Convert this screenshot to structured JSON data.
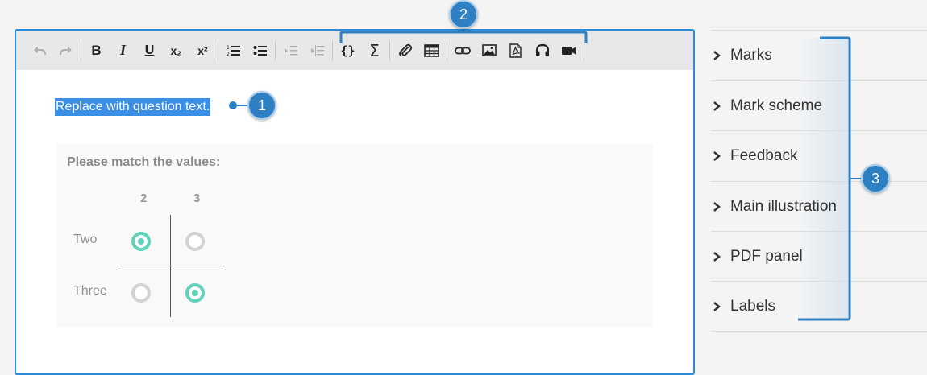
{
  "toolbar": {
    "buttons": [
      {
        "name": "undo",
        "icon": "undo-icon",
        "glyph": "↶"
      },
      {
        "name": "redo",
        "icon": "redo-icon",
        "glyph": "↷"
      },
      {
        "name": "bold",
        "label": "B"
      },
      {
        "name": "italic",
        "label": "I"
      },
      {
        "name": "underline",
        "label": "U"
      },
      {
        "name": "subscript",
        "label": "x₂"
      },
      {
        "name": "superscript",
        "label": "x²"
      },
      {
        "name": "ordered-list",
        "icon": "ordered-list-icon"
      },
      {
        "name": "bullet-list",
        "icon": "bullet-list-icon"
      },
      {
        "name": "outdent",
        "icon": "outdent-icon"
      },
      {
        "name": "indent",
        "icon": "indent-icon"
      },
      {
        "name": "variable",
        "label": "{}"
      },
      {
        "name": "math",
        "label": "Σ"
      },
      {
        "name": "attachment",
        "icon": "paperclip-icon"
      },
      {
        "name": "table",
        "icon": "table-icon"
      },
      {
        "name": "link",
        "icon": "link-icon"
      },
      {
        "name": "image",
        "icon": "image-icon"
      },
      {
        "name": "pdf",
        "icon": "pdf-icon"
      },
      {
        "name": "audio",
        "icon": "headphones-icon"
      },
      {
        "name": "video",
        "icon": "video-camera-icon"
      }
    ]
  },
  "editor": {
    "question_text": "Replace with question text."
  },
  "matching": {
    "title": "Please match the values:",
    "columns": [
      "2",
      "3"
    ],
    "rows": [
      {
        "label": "Two",
        "selected_column": "2"
      },
      {
        "label": "Three",
        "selected_column": "3"
      }
    ]
  },
  "side_panel": {
    "items": [
      {
        "label": "Marks"
      },
      {
        "label": "Mark scheme"
      },
      {
        "label": "Feedback"
      },
      {
        "label": "Main illustration"
      },
      {
        "label": "PDF panel"
      },
      {
        "label": "Labels"
      }
    ]
  },
  "callouts": [
    "1",
    "2",
    "3"
  ],
  "colors": {
    "accent": "#2b8bd6",
    "callout": "#2f7fc3",
    "selection": "#3a8ee6",
    "radio_checked": "#62d1bb",
    "radio_unchecked": "#d2d2d2"
  }
}
